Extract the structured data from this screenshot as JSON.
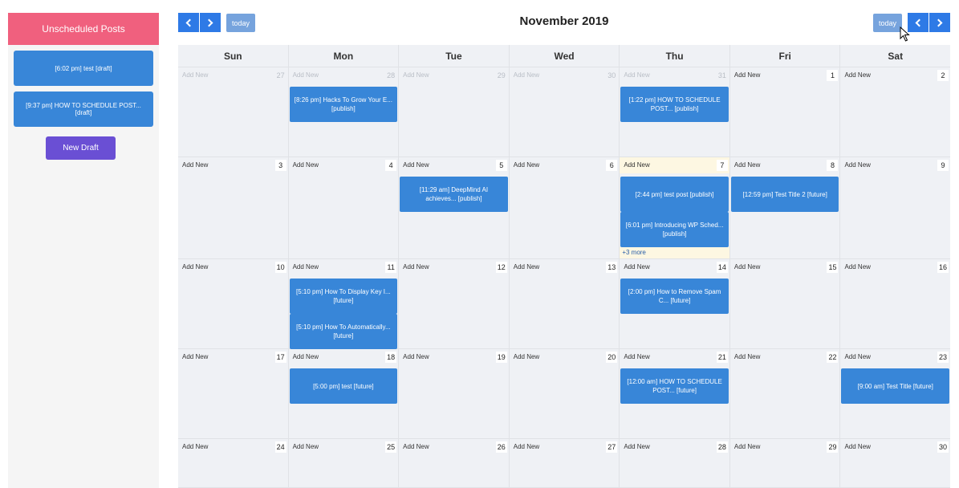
{
  "sidebar": {
    "title": "Unscheduled Posts",
    "drafts": [
      {
        "label": "[6:02 pm] test [draft]"
      },
      {
        "label": "[9:37 pm] HOW TO SCHEDULE POST... [draft]"
      }
    ],
    "new_draft_label": "New Draft"
  },
  "toolbar": {
    "title": "November 2019",
    "today_label": "today"
  },
  "calendar": {
    "add_new_label": "Add New",
    "days_of_week": [
      "Sun",
      "Mon",
      "Tue",
      "Wed",
      "Thu",
      "Fri",
      "Sat"
    ],
    "weeks": [
      {
        "days": [
          {
            "num": "27",
            "other": true,
            "events": []
          },
          {
            "num": "28",
            "other": true,
            "events": [
              "[8:26 pm] Hacks To Grow Your E... [publish]"
            ]
          },
          {
            "num": "29",
            "other": true,
            "events": []
          },
          {
            "num": "30",
            "other": true,
            "events": []
          },
          {
            "num": "31",
            "other": true,
            "events": [
              "[1:22 pm] HOW TO SCHEDULE POST... [publish]"
            ]
          },
          {
            "num": "1",
            "other": false,
            "events": []
          },
          {
            "num": "2",
            "other": false,
            "events": []
          }
        ]
      },
      {
        "days": [
          {
            "num": "3",
            "other": false,
            "events": []
          },
          {
            "num": "4",
            "other": false,
            "events": []
          },
          {
            "num": "5",
            "other": false,
            "events": [
              "[11:29 am] DeepMind AI achieves... [publish]"
            ]
          },
          {
            "num": "6",
            "other": false,
            "events": []
          },
          {
            "num": "7",
            "other": false,
            "today": true,
            "events": [
              "[2:44 pm] test post [publish]",
              "[6:01 pm] Introducing WP Sched... [publish]"
            ],
            "more": "+3 more"
          },
          {
            "num": "8",
            "other": false,
            "events": [
              "[12:59 pm] Test Title 2 [future]"
            ]
          },
          {
            "num": "9",
            "other": false,
            "events": []
          }
        ]
      },
      {
        "days": [
          {
            "num": "10",
            "other": false,
            "events": []
          },
          {
            "num": "11",
            "other": false,
            "events": [
              "[5:10 pm] How To Display Key I... [future]",
              "[5:10 pm] How To Automatically... [future]"
            ]
          },
          {
            "num": "12",
            "other": false,
            "events": []
          },
          {
            "num": "13",
            "other": false,
            "events": []
          },
          {
            "num": "14",
            "other": false,
            "events": [
              "[2:00 pm] How to Remove Spam C... [future]"
            ]
          },
          {
            "num": "15",
            "other": false,
            "events": []
          },
          {
            "num": "16",
            "other": false,
            "events": []
          }
        ]
      },
      {
        "days": [
          {
            "num": "17",
            "other": false,
            "events": []
          },
          {
            "num": "18",
            "other": false,
            "events": [
              "[5:00 pm] test [future]"
            ]
          },
          {
            "num": "19",
            "other": false,
            "events": []
          },
          {
            "num": "20",
            "other": false,
            "events": []
          },
          {
            "num": "21",
            "other": false,
            "events": [
              "[12:00 am] HOW TO SCHEDULE POST... [future]"
            ]
          },
          {
            "num": "22",
            "other": false,
            "events": []
          },
          {
            "num": "23",
            "other": false,
            "events": [
              "[9:00 am] Test Title [future]"
            ]
          }
        ]
      },
      {
        "days": [
          {
            "num": "24",
            "other": false,
            "events": []
          },
          {
            "num": "25",
            "other": false,
            "events": []
          },
          {
            "num": "26",
            "other": false,
            "events": []
          },
          {
            "num": "27",
            "other": false,
            "events": []
          },
          {
            "num": "28",
            "other": false,
            "events": []
          },
          {
            "num": "29",
            "other": false,
            "events": []
          },
          {
            "num": "30",
            "other": false,
            "events": []
          }
        ]
      }
    ]
  },
  "colors": {
    "sidebar_header": "#f0607e",
    "event": "#3886d8",
    "new_draft": "#6a4fd4",
    "nav_button": "#2e7ae6",
    "today_button": "#76a3dd",
    "today_cell": "#fdf7e2"
  },
  "icons": {
    "prev": "chevron-left-icon",
    "next": "chevron-right-icon",
    "cursor": "mouse-pointer-icon"
  }
}
